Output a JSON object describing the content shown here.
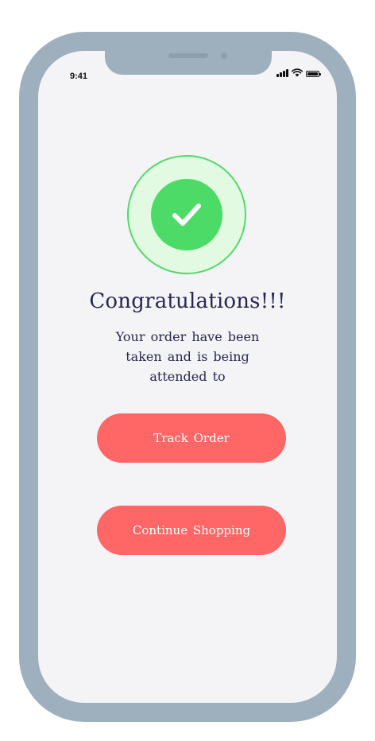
{
  "status_bar": {
    "time": "9:41",
    "icons": [
      "signal-icon",
      "wifi-icon",
      "battery-icon"
    ]
  },
  "success_badge": {
    "icon": "checkmark-icon",
    "colors": {
      "outer_fill": "#e1fae1",
      "outer_ring": "#55d86a",
      "inner_fill": "#4cdb66"
    }
  },
  "confirmation": {
    "title": "Congratulations!!!",
    "message": "Your order have been taken and is being attended to"
  },
  "actions": {
    "track_order_label": "Track Order",
    "continue_shopping_label": "Continue Shopping"
  },
  "theme": {
    "accent": "#ff6766",
    "text": "#262850",
    "background": "#f4f3f6",
    "frame": "#9eb0bd"
  }
}
